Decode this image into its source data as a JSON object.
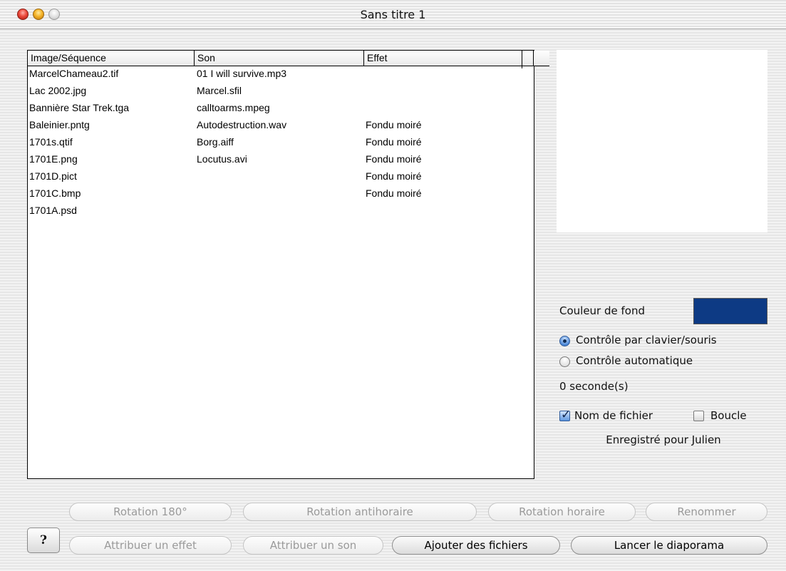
{
  "window": {
    "title": "Sans titre 1"
  },
  "table": {
    "columns": [
      "Image/Séquence",
      "Son",
      "Effet"
    ],
    "rows": [
      {
        "image": "MarcelChameau2.tif",
        "sound": "01 I will survive.mp3",
        "effect": ""
      },
      {
        "image": "Lac 2002.jpg",
        "sound": "Marcel.sfil",
        "effect": ""
      },
      {
        "image": "Bannière Star Trek.tga",
        "sound": "calltoarms.mpeg",
        "effect": ""
      },
      {
        "image": "Baleinier.pntg",
        "sound": "Autodestruction.wav",
        "effect": "Fondu moiré"
      },
      {
        "image": "1701s.qtif",
        "sound": "Borg.aiff",
        "effect": "Fondu moiré"
      },
      {
        "image": "1701E.png",
        "sound": "Locutus.avi",
        "effect": "Fondu moiré"
      },
      {
        "image": "1701D.pict",
        "sound": "",
        "effect": "Fondu moiré"
      },
      {
        "image": "1701C.bmp",
        "sound": "",
        "effect": "Fondu moiré"
      },
      {
        "image": "1701A.psd",
        "sound": "",
        "effect": ""
      }
    ]
  },
  "options": {
    "background_color_label": "Couleur de fond",
    "background_color": "#0d3a84",
    "radio_keyboard": "Contrôle par clavier/souris",
    "radio_auto": "Contrôle automatique",
    "selected_control": "Contrôle par clavier/souris",
    "seconds": "0 seconde(s)",
    "filename_label": "Nom de fichier",
    "filename_checked": true,
    "loop_label": "Boucle",
    "loop_checked": false,
    "registered": "Enregistré pour Julien"
  },
  "buttons": {
    "help": "?",
    "rotate_180": "Rotation 180°",
    "rotate_ccw": "Rotation antihoraire",
    "rotate_cw": "Rotation horaire",
    "rename": "Renommer",
    "assign_effect": "Attribuer un effet",
    "assign_sound": "Attribuer un son",
    "add_files": "Ajouter des fichiers",
    "start_slideshow": "Lancer le diaporama"
  }
}
